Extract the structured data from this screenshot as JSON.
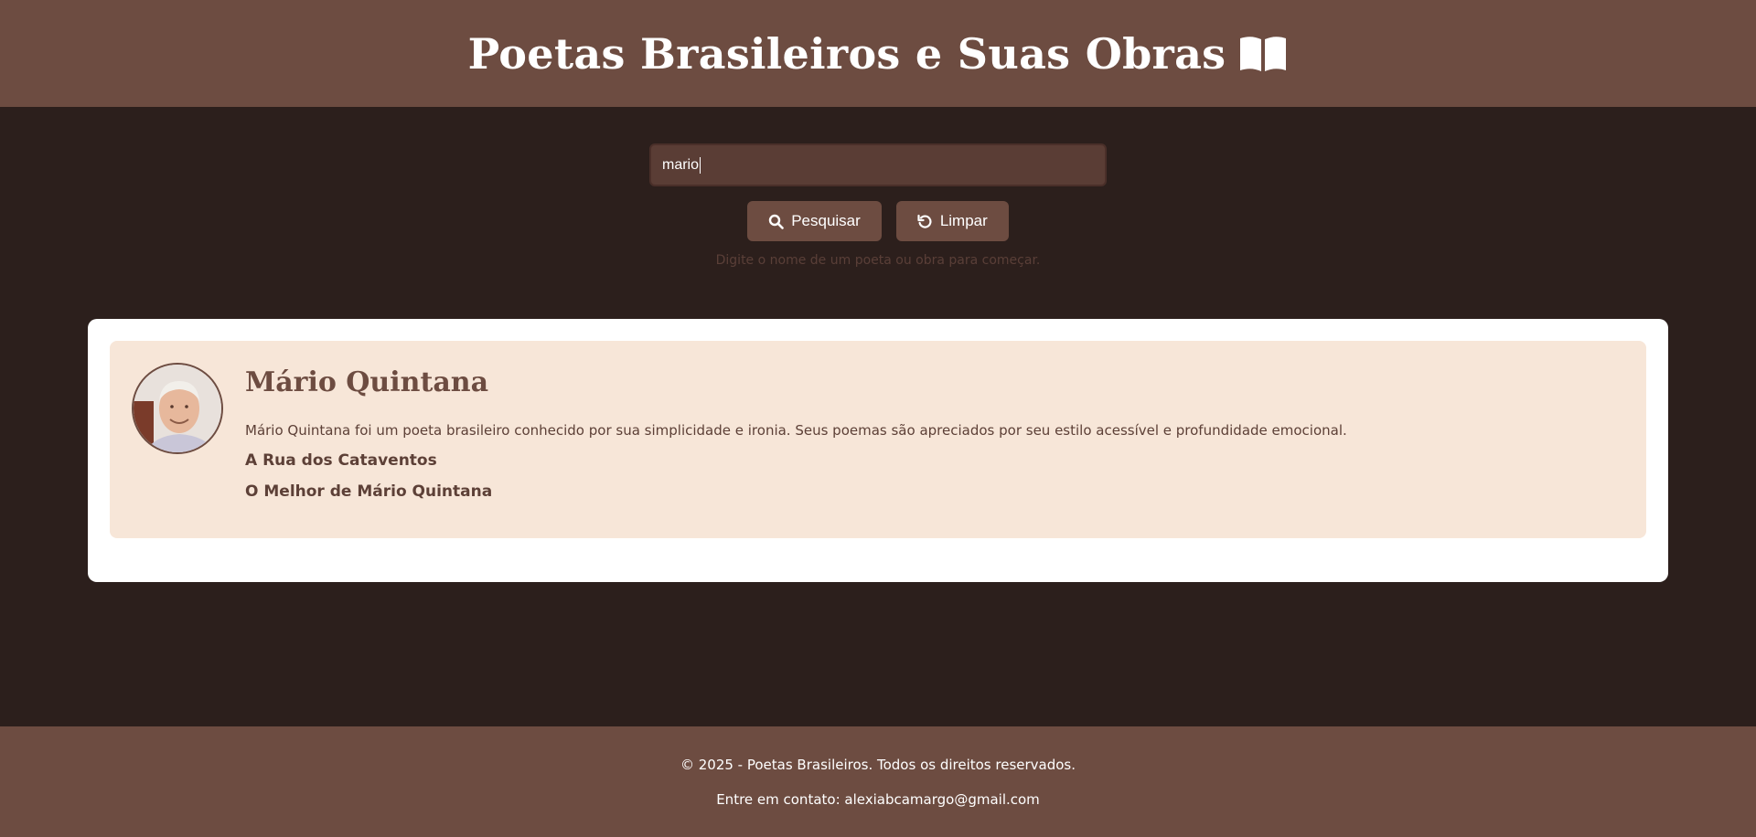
{
  "header": {
    "title": "Poetas Brasileiros e Suas Obras",
    "title_icon": "open-book-icon"
  },
  "search": {
    "value": "mario",
    "search_button_label": "Pesquisar",
    "search_button_icon": "search-icon",
    "clear_button_label": "Limpar",
    "clear_button_icon": "reset-icon",
    "hint": "Digite o nome de um poeta ou obra para começar."
  },
  "results": [
    {
      "name": "Mário Quintana",
      "bio": "Mário Quintana foi um poeta brasileiro conhecido por sua simplicidade e ironia. Seus poemas são apreciados por seu estilo acessível e profundidade emocional.",
      "works": [
        "A Rua dos Cataventos",
        "O Melhor de Mário Quintana"
      ]
    }
  ],
  "footer": {
    "copyright": "© 2025 - Poetas Brasileiros. Todos os direitos reservados.",
    "contact": "Entre em contato: alexiabcamargo@gmail.com"
  },
  "colors": {
    "header_bg": "#6d4c41",
    "page_bg": "#2c1f1c",
    "card_bg": "#f7e6d8",
    "accent_text": "#6d4c41"
  }
}
